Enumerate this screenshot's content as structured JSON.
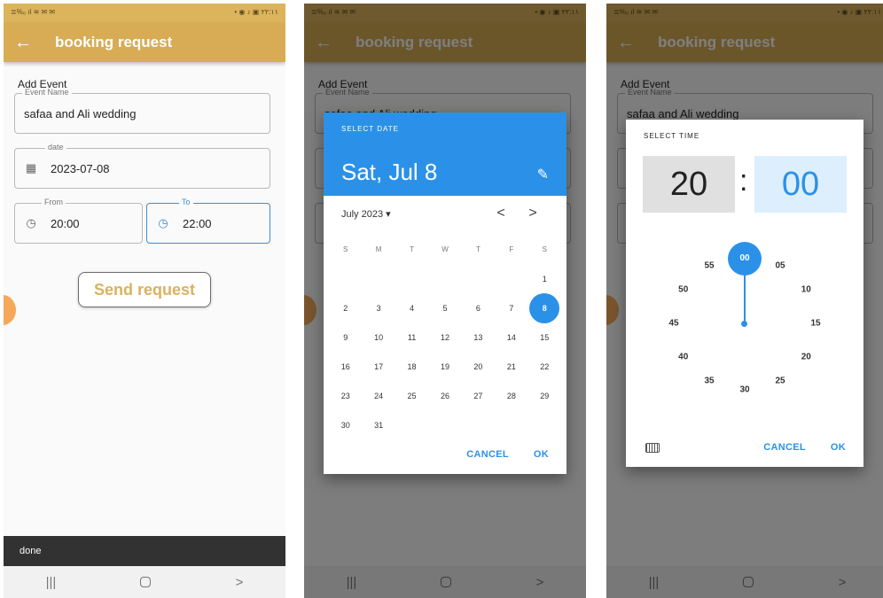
{
  "status": {
    "left": "≣%₀ ıl ≋ ✉ ✉",
    "right": "• ◉ ♪ ▣ ۲۲:۱۱"
  },
  "app": {
    "back_icon": "arrow-left-icon",
    "title": "booking request"
  },
  "form": {
    "section_label": "Add Event",
    "event_name_legend": "Event Name",
    "event_name_value": "safaa and Ali wedding",
    "date_legend": "date",
    "date_value": "2023-07-08",
    "from_legend": "From",
    "from_value": "20:00",
    "to_legend": "To",
    "to_value": "22:00",
    "send_label": "Send request"
  },
  "snackbar": {
    "text": "done"
  },
  "navbar": {
    "recent": "|||",
    "home": "",
    "back": ">"
  },
  "date_picker": {
    "header_label": "SELECT DATE",
    "selected_date": "Sat, Jul 8",
    "month_label": "July 2023 ▾",
    "prev": "<",
    "next": ">",
    "weekdays": [
      "S",
      "M",
      "T",
      "W",
      "T",
      "F",
      "S"
    ],
    "days": [
      "",
      "",
      "",
      "",
      "",
      "",
      "1",
      "2",
      "3",
      "4",
      "5",
      "6",
      "7",
      "8",
      "9",
      "10",
      "11",
      "12",
      "13",
      "14",
      "15",
      "16",
      "17",
      "18",
      "19",
      "20",
      "21",
      "22",
      "23",
      "24",
      "25",
      "26",
      "27",
      "28",
      "29",
      "30",
      "31"
    ],
    "selected_day": "8",
    "cancel": "CANCEL",
    "ok": "OK"
  },
  "time_picker": {
    "header_label": "SELECT TIME",
    "hour": "20",
    "separator": ":",
    "minute": "00",
    "dial": [
      "00",
      "05",
      "10",
      "15",
      "20",
      "25",
      "30",
      "35",
      "40",
      "45",
      "50",
      "55"
    ],
    "selected_minute": "00",
    "cancel": "CANCEL",
    "ok": "OK"
  },
  "colors": {
    "appbar": "#d7ac55",
    "accent": "#2b91e8",
    "send_text": "#d9b25f"
  }
}
